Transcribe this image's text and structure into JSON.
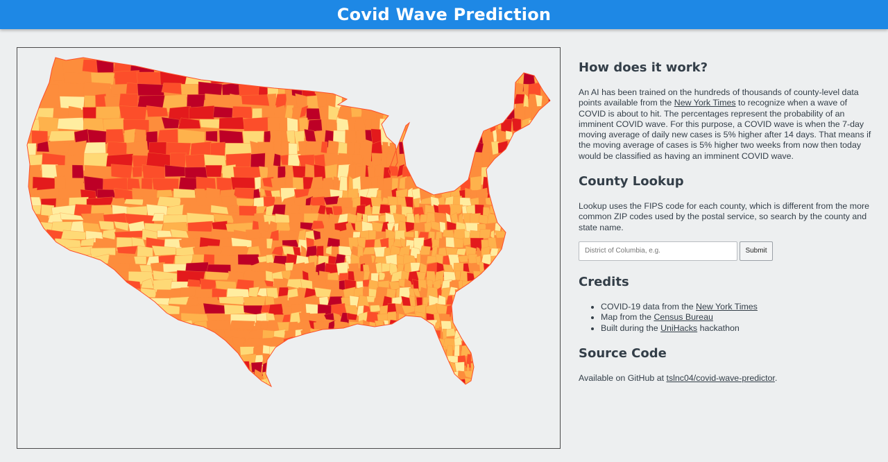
{
  "header": {
    "title": "Covid Wave Prediction"
  },
  "map": {
    "name": "US county COVID wave probability map"
  },
  "how": {
    "heading": "How does it work?",
    "p1_before": "An AI has been trained on the hundreds of thousands of county-level data points available from the ",
    "p1_link": "New York Times",
    "p1_after": " to recognize when a wave of COVID is about to hit. The percentages represent the probability of an imminent COVID wave. For this purpose, a COVID wave is when the 7-day moving average of daily new cases is 5% higher after 14 days. That means if the moving average of cases is 5% higher two weeks from now then today would be classified as having an imminent COVID wave."
  },
  "lookup": {
    "heading": "County Lookup",
    "description": "Lookup uses the FIPS code for each county, which is different from the more common ZIP codes used by the postal service, so search by the county and state name.",
    "placeholder": "District of Columbia, e.g.",
    "value": "",
    "submit_label": "Submit"
  },
  "credits": {
    "heading": "Credits",
    "items": [
      {
        "before": "COVID-19 data from the ",
        "link": "New York Times",
        "after": ""
      },
      {
        "before": "Map from the ",
        "link": "Census Bureau",
        "after": ""
      },
      {
        "before": "Built during the ",
        "link": "UniHacks",
        "after": " hackathon"
      }
    ]
  },
  "source": {
    "heading": "Source Code",
    "before": "Available on GitHub at ",
    "link": "tslnc04/covid-wave-predictor",
    "after": "."
  },
  "colors": {
    "header_bg": "#1e88e5",
    "page_bg": "#edeff0",
    "scale": [
      "#ffeda0",
      "#fed976",
      "#feb24c",
      "#fd8d3c",
      "#fc4e2a",
      "#e31a1c",
      "#bd0026"
    ]
  }
}
